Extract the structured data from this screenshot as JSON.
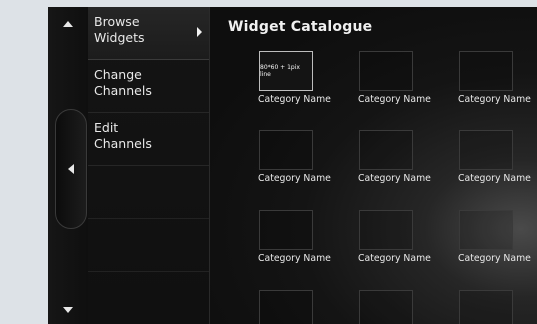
{
  "menu": {
    "items": [
      {
        "label": "Browse\nWidgets",
        "active": true
      },
      {
        "label": "Change\nChannels",
        "active": false
      },
      {
        "label": "Edit\nChannels",
        "active": false
      }
    ]
  },
  "catalogue": {
    "title": "Widget Catalogue",
    "first_thumb_label": "80*60 + 1pix line",
    "rows": [
      [
        "Category Name",
        "Category Name",
        "Category Name"
      ],
      [
        "Category Name",
        "Category Name",
        "Category Name"
      ],
      [
        "Category Name",
        "Category Name",
        "Category Name"
      ],
      [
        "",
        "",
        ""
      ]
    ]
  },
  "icons": {
    "rail_up": "arrow-up-icon",
    "rail_left": "arrow-left-icon",
    "rail_down": "arrow-down-icon",
    "menu_selected": "chevron-right-icon"
  }
}
